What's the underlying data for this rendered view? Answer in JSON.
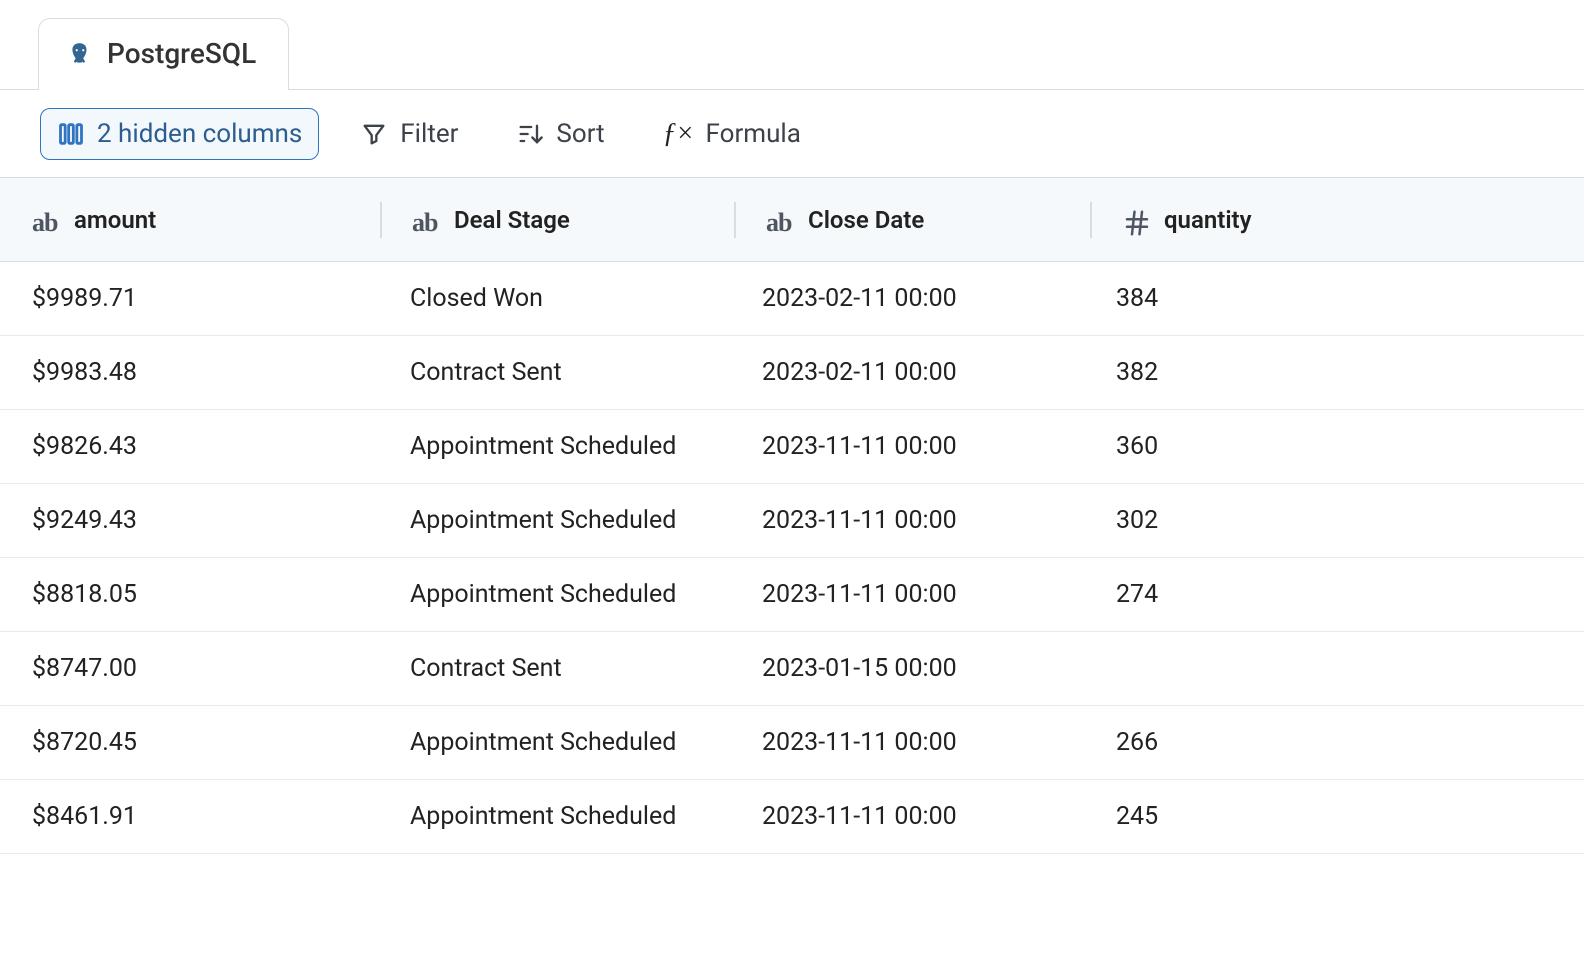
{
  "tab": {
    "label": "PostgreSQL"
  },
  "toolbar": {
    "hidden_columns_label": "2 hidden columns",
    "filter_label": "Filter",
    "sort_label": "Sort",
    "formula_label": "Formula"
  },
  "columns": [
    {
      "key": "amount",
      "label": "amount",
      "type": "text"
    },
    {
      "key": "deal_stage",
      "label": "Deal Stage",
      "type": "text"
    },
    {
      "key": "close_date",
      "label": "Close Date",
      "type": "text"
    },
    {
      "key": "quantity",
      "label": "quantity",
      "type": "number"
    }
  ],
  "rows": [
    {
      "amount": "$9989.71",
      "deal_stage": "Closed Won",
      "close_date": "2023-02-11 00:00",
      "quantity": "384"
    },
    {
      "amount": "$9983.48",
      "deal_stage": "Contract Sent",
      "close_date": "2023-02-11 00:00",
      "quantity": "382"
    },
    {
      "amount": "$9826.43",
      "deal_stage": "Appointment Scheduled",
      "close_date": "2023-11-11 00:00",
      "quantity": "360"
    },
    {
      "amount": "$9249.43",
      "deal_stage": "Appointment Scheduled",
      "close_date": "2023-11-11 00:00",
      "quantity": "302"
    },
    {
      "amount": "$8818.05",
      "deal_stage": "Appointment Scheduled",
      "close_date": "2023-11-11 00:00",
      "quantity": "274"
    },
    {
      "amount": "$8747.00",
      "deal_stage": "Contract Sent",
      "close_date": "2023-01-15 00:00",
      "quantity": ""
    },
    {
      "amount": "$8720.45",
      "deal_stage": "Appointment Scheduled",
      "close_date": "2023-11-11 00:00",
      "quantity": "266"
    },
    {
      "amount": "$8461.91",
      "deal_stage": "Appointment Scheduled",
      "close_date": "2023-11-11 00:00",
      "quantity": "245"
    }
  ]
}
